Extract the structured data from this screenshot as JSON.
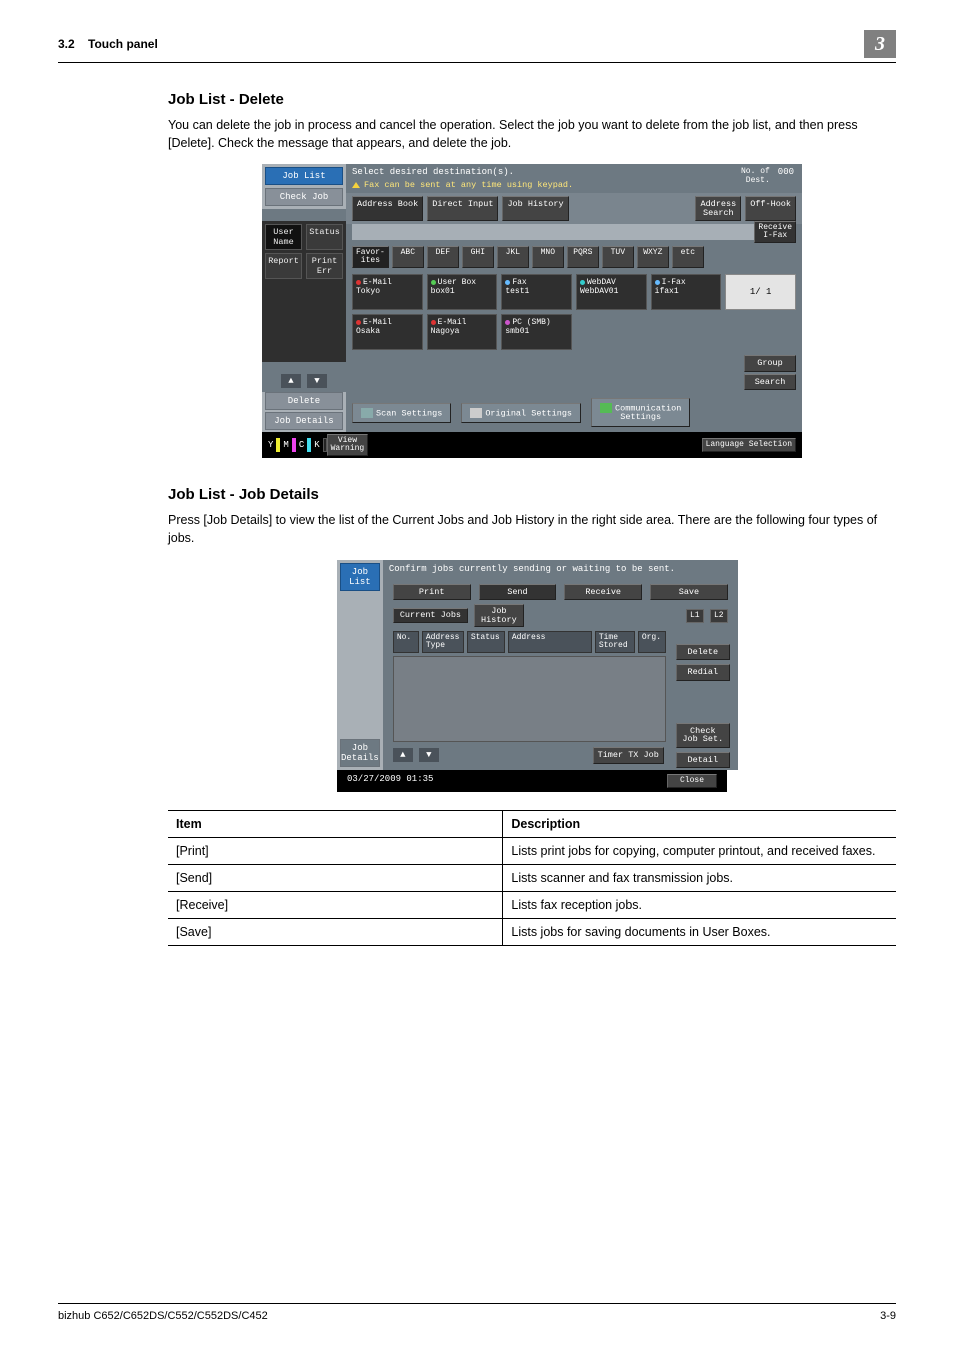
{
  "header": {
    "section": "3.2",
    "title": "Touch panel",
    "badge": "3"
  },
  "sections": {
    "delete": {
      "heading": "Job List - Delete",
      "body": "You can delete the job in process and cancel the operation. Select the job you want to delete from the job list, and then press [Delete]. Check the message that appears, and delete the job."
    },
    "details": {
      "heading": "Job List - Job Details",
      "body": "Press [Job Details] to view the list of the Current Jobs and Job History in the right side area. There are the following four types of jobs."
    }
  },
  "shot1": {
    "tabs": {
      "joblist": "Job List",
      "checkjob": "Check Job"
    },
    "subtabs_left": {
      "user": "User\nName",
      "status": "Status",
      "report": "Report",
      "printerr": "Print Err"
    },
    "msg": "Select desired destination(s).",
    "hint": "Fax can be sent at any time using keypad.",
    "no_of_label": "No. of\nDest.",
    "no_of_val": "000",
    "ctrl": {
      "addr": "Address Book",
      "direct": "Direct Input",
      "hist": "Job History",
      "addrsearch": "Address\nSearch",
      "offhook": "Off-Hook",
      "recv": "Receive\nI-Fax"
    },
    "idx": [
      "Favor-\nites",
      "ABC",
      "DEF",
      "GHI",
      "JKL",
      "MNO",
      "PQRS",
      "TUV",
      "WXYZ",
      "etc"
    ],
    "dest": [
      {
        "t1": "E-Mail",
        "t2": "Tokyo",
        "c": "red"
      },
      {
        "t1": "User Box",
        "t2": "box01",
        "c": "grn"
      },
      {
        "t1": "Fax",
        "t2": "test1",
        "c": "blu"
      },
      {
        "t1": "WebDAV",
        "t2": "WebDAV01",
        "c": "cyan"
      },
      {
        "t1": "I-Fax",
        "t2": "ifax1",
        "c": "blu"
      },
      {
        "page": "1/ 1"
      },
      {
        "t1": "E-Mail",
        "t2": "Osaka",
        "c": "red"
      },
      {
        "t1": "E-Mail",
        "t2": "Nagoya",
        "c": "red"
      },
      {
        "t1": "PC (SMB)",
        "t2": "smb01",
        "c": "mag"
      }
    ],
    "sidebtn": {
      "group": "Group",
      "search": "Search"
    },
    "leftbtm": {
      "delete": "Delete",
      "jobdetails": "Job Details"
    },
    "botrow": {
      "scan": "Scan Settings",
      "orig": "Original Settings",
      "comm": "Communication\nSettings"
    },
    "footer": {
      "view": "View\nWarning",
      "lang": "Language Selection",
      "ymck": [
        "Y",
        "M",
        "C",
        "K"
      ]
    }
  },
  "shot2": {
    "tabs": {
      "joblist": "Job List",
      "jobdetails": "Job Details"
    },
    "msg": "Confirm jobs currently sending or waiting to be sent.",
    "maintabs": [
      "Print",
      "Send",
      "Receive",
      "Save"
    ],
    "sub": {
      "cur": "Current Jobs",
      "hist": "Job\nHistory",
      "l1": "L1",
      "l2": "L2"
    },
    "cols": [
      "No.",
      "Address\nType",
      "Status",
      "Address",
      "Time\nStored",
      "Org."
    ],
    "side": {
      "delete": "Delete",
      "redial": "Redial",
      "check": "Check\nJob Set.",
      "detail": "Detail"
    },
    "low": {
      "timer": "Timer TX Job"
    },
    "foot": {
      "ts": "03/27/2009   01:35",
      "close": "Close"
    }
  },
  "table": {
    "h1": "Item",
    "h2": "Description",
    "rows": [
      {
        "i": "[Print]",
        "d": "Lists print jobs for copying, computer printout, and received faxes."
      },
      {
        "i": "[Send]",
        "d": "Lists scanner and fax transmission jobs."
      },
      {
        "i": "[Receive]",
        "d": "Lists fax reception jobs."
      },
      {
        "i": "[Save]",
        "d": "Lists jobs for saving documents in User Boxes."
      }
    ]
  },
  "footer": {
    "model": "bizhub C652/C652DS/C552/C552DS/C452",
    "page": "3-9"
  }
}
